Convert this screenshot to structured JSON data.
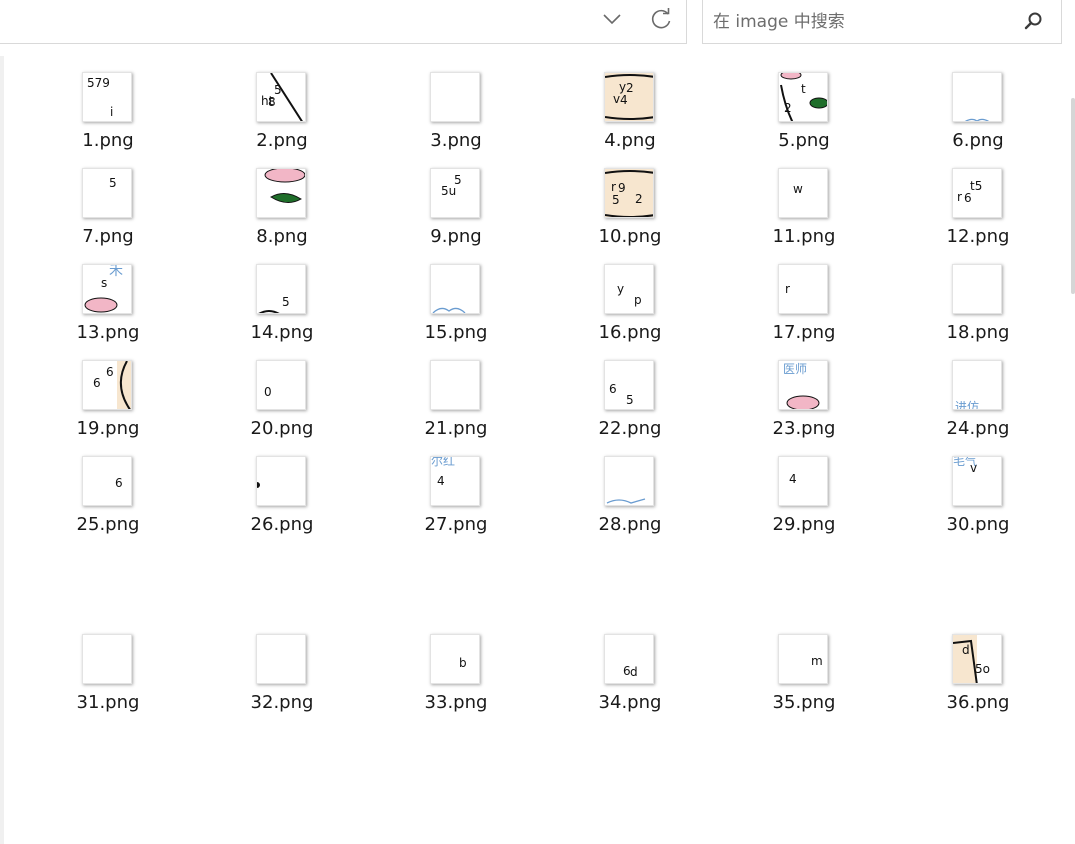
{
  "search": {
    "placeholder": "在 image 中搜索",
    "value": ""
  },
  "icons": {
    "dropdown": "chevron-down-icon",
    "refresh": "refresh-icon",
    "search": "search-icon"
  },
  "colors": {
    "accent_pink": "#f2b6c6",
    "leaf_green": "#1f6e2a",
    "paper_beige": "#f7e6cf",
    "sketch_blue": "#6a9cd0"
  },
  "files": [
    {
      "name": "1.png",
      "chars": "579 i"
    },
    {
      "name": "2.png",
      "chars": "8 ht 5"
    },
    {
      "name": "3.png",
      "chars": ""
    },
    {
      "name": "4.png",
      "chars": "4 v 2 y"
    },
    {
      "name": "5.png",
      "chars": "t 2"
    },
    {
      "name": "6.png",
      "chars": ""
    },
    {
      "name": "7.png",
      "chars": "5"
    },
    {
      "name": "8.png",
      "chars": ""
    },
    {
      "name": "9.png",
      "chars": "5u 5"
    },
    {
      "name": "10.png",
      "chars": "5 2 9 r"
    },
    {
      "name": "11.png",
      "chars": "w"
    },
    {
      "name": "12.png",
      "chars": "6 r t5"
    },
    {
      "name": "13.png",
      "chars": "s"
    },
    {
      "name": "14.png",
      "chars": "5"
    },
    {
      "name": "15.png",
      "chars": ""
    },
    {
      "name": "16.png",
      "chars": "p y"
    },
    {
      "name": "17.png",
      "chars": "r"
    },
    {
      "name": "18.png",
      "chars": ""
    },
    {
      "name": "19.png",
      "chars": "6 6"
    },
    {
      "name": "20.png",
      "chars": "0"
    },
    {
      "name": "21.png",
      "chars": ""
    },
    {
      "name": "22.png",
      "chars": "5 6"
    },
    {
      "name": "23.png",
      "chars": ""
    },
    {
      "name": "24.png",
      "chars": ""
    },
    {
      "name": "25.png",
      "chars": "6"
    },
    {
      "name": "26.png",
      "chars": ""
    },
    {
      "name": "27.png",
      "chars": "4"
    },
    {
      "name": "28.png",
      "chars": ""
    },
    {
      "name": "29.png",
      "chars": "4"
    },
    {
      "name": "30.png",
      "chars": "v"
    },
    {
      "name": "31.png",
      "chars": ""
    },
    {
      "name": "32.png",
      "chars": ""
    },
    {
      "name": "33.png",
      "chars": "b"
    },
    {
      "name": "34.png",
      "chars": "d 6"
    },
    {
      "name": "35.png",
      "chars": "m"
    },
    {
      "name": "36.png",
      "chars": "d 5o"
    }
  ]
}
